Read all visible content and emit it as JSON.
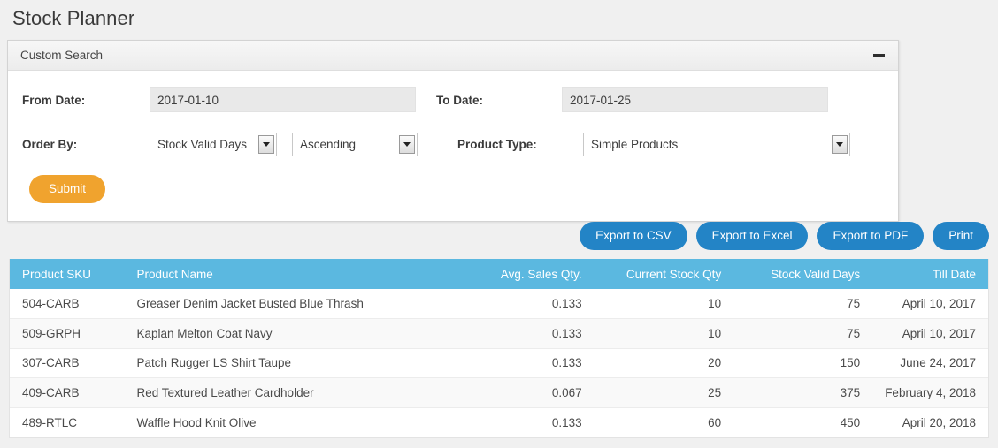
{
  "page": {
    "title": "Stock Planner"
  },
  "search_panel": {
    "header_title": "Custom Search",
    "collapse_icon": "minus-icon",
    "fields": {
      "from_date_label": "From Date:",
      "from_date_value": "2017-01-10",
      "to_date_label": "To Date:",
      "to_date_value": "2017-01-25",
      "order_by_label": "Order By:",
      "order_by_value": "Stock Valid Days",
      "order_dir_value": "Ascending",
      "product_type_label": "Product Type:",
      "product_type_value": "Simple Products"
    },
    "submit_label": "Submit"
  },
  "export_bar": {
    "buttons": [
      {
        "label": "Export to CSV"
      },
      {
        "label": "Export to Excel"
      },
      {
        "label": "Export to PDF"
      },
      {
        "label": "Print"
      }
    ]
  },
  "table": {
    "columns": [
      "Product SKU",
      "Product Name",
      "Avg. Sales Qty.",
      "Current Stock Qty",
      "Stock Valid Days",
      "Till Date"
    ],
    "rows": [
      {
        "sku": "504-CARB",
        "name": "Greaser Denim Jacket Busted Blue Thrash",
        "avg_sales_qty": "0.133",
        "current_stock_qty": "10",
        "stock_valid_days": "75",
        "till_date": "April 10, 2017"
      },
      {
        "sku": "509-GRPH",
        "name": "Kaplan Melton Coat Navy",
        "avg_sales_qty": "0.133",
        "current_stock_qty": "10",
        "stock_valid_days": "75",
        "till_date": "April 10, 2017"
      },
      {
        "sku": "307-CARB",
        "name": "Patch Rugger LS Shirt Taupe",
        "avg_sales_qty": "0.133",
        "current_stock_qty": "20",
        "stock_valid_days": "150",
        "till_date": "June 24, 2017"
      },
      {
        "sku": "409-CARB",
        "name": "Red Textured Leather Cardholder",
        "avg_sales_qty": "0.067",
        "current_stock_qty": "25",
        "stock_valid_days": "375",
        "till_date": "February 4, 2018"
      },
      {
        "sku": "489-RTLC",
        "name": "Waffle Hood Knit Olive",
        "avg_sales_qty": "0.133",
        "current_stock_qty": "60",
        "stock_valid_days": "450",
        "till_date": "April 20, 2018"
      }
    ]
  },
  "colors": {
    "page_background": "#f0f0f0",
    "table_header": "#5bb8e0",
    "export_button": "#2384c6",
    "submit_button": "#f0a32e",
    "panel_header": "#ececec"
  }
}
